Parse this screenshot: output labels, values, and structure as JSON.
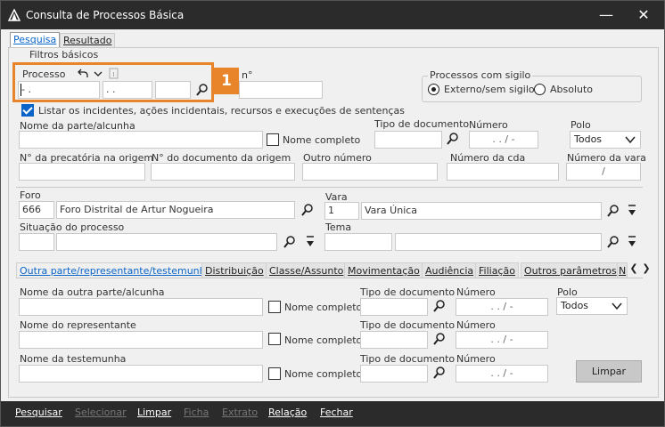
{
  "window": {
    "title": "Consulta de Processos Básica"
  },
  "tabs": [
    "Pesquisa",
    "Resultado"
  ],
  "filters": {
    "group_label": "Filtros básicos",
    "processo_label": "Processo",
    "processo_field1": "   -  .",
    "processo_field2": " .  .",
    "badge": "1",
    "other_label_fragment": "n°",
    "sigilo_label": "Processos com sigilo",
    "sigilo_opt1": "Externo/sem sigilo",
    "sigilo_opt2": "Absoluto",
    "listar_label": "Listar os incidentes, ações incidentais, recursos e execuções de sentenças",
    "nome_parte_label": "Nome da parte/alcunha",
    "nome_completo_label": "Nome completo",
    "tipo_doc_label": "Tipo de documento",
    "numero_label": "Número",
    "numero_value": " .  .  /  -",
    "polo_label": "Polo",
    "polo_value": "Todos",
    "precatoria_label": "N° da precatória na origem",
    "doc_origem_label": "N° do documento da origem",
    "outro_numero_label": "Outro número",
    "numero_cda_label": "Número da cda",
    "numero_vara_label": "Número da vara",
    "numero_vara_value": "/"
  },
  "foro": {
    "label": "Foro",
    "code": "666",
    "name": "Foro Distrital de Artur Nogueira"
  },
  "vara": {
    "label": "Vara",
    "code": "1",
    "name": "Vara Única"
  },
  "situacao": {
    "label": "Situação do processo"
  },
  "tema": {
    "label": "Tema"
  },
  "subtabs": [
    "Outra parte/representante/testemunha",
    "Distribuição",
    "Classe/Assunto",
    "Movimentação",
    "Audiência",
    "Filiação",
    "Outros parâmetros",
    "N"
  ],
  "other_party": {
    "nome_outra_label": "Nome da outra parte/alcunha",
    "nome_rep_label": "Nome do representante",
    "nome_test_label": "Nome da testemunha",
    "nome_completo": "Nome completo",
    "tipo_doc": "Tipo de documento",
    "numero": "Número",
    "numero_value": " .  .  /  -",
    "numero_value2": " .  .  /  -",
    "polo": "Polo",
    "polo_value": "Todos",
    "limpar": "Limpar"
  },
  "bottom": [
    "Pesquisar",
    "Selecionar",
    "Limpar",
    "Ficha",
    "Extrato",
    "Relação",
    "Fechar"
  ],
  "colors": {
    "accent": "#e8852a",
    "blue": "#0a64c8"
  }
}
